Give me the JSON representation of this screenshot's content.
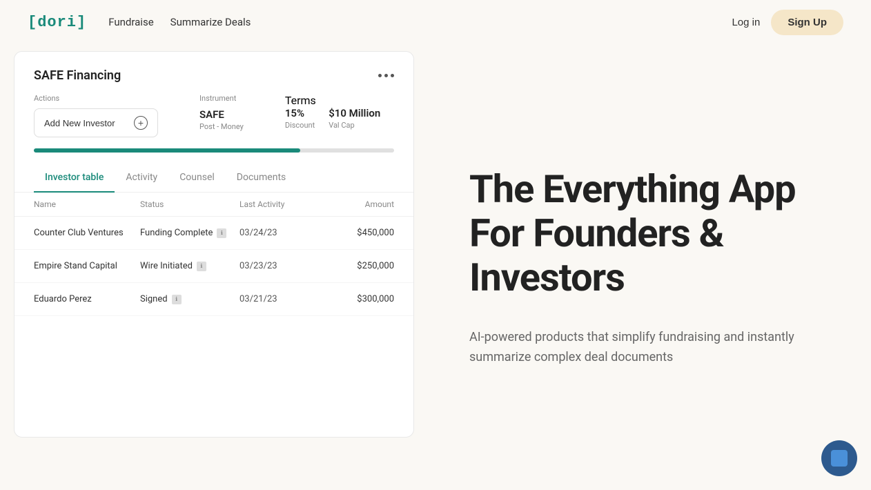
{
  "header": {
    "logo": "[dori]",
    "nav": {
      "fundraise": "Fundraise",
      "summarize_deals": "Summarize Deals"
    },
    "login_label": "Log in",
    "signup_label": "Sign Up"
  },
  "panel": {
    "title": "SAFE Financing",
    "actions_label": "Actions",
    "add_investor_label": "Add New Investor",
    "instrument_label": "Instrument",
    "instrument_value": "SAFE",
    "instrument_sub": "Post - Money",
    "terms_label": "Terms",
    "discount_value": "15%",
    "discount_sub": "Discount",
    "valcap_value": "$10 Million",
    "valcap_sub": "Val Cap",
    "progress_percent": 74,
    "tabs": [
      {
        "id": "investor-table",
        "label": "Investor table",
        "active": true
      },
      {
        "id": "activity",
        "label": "Activity",
        "active": false
      },
      {
        "id": "counsel",
        "label": "Counsel",
        "active": false
      },
      {
        "id": "documents",
        "label": "Documents",
        "active": false
      }
    ],
    "table": {
      "columns": [
        "Name",
        "Status",
        "Last Activity",
        "Amount"
      ],
      "rows": [
        {
          "name": "Counter Club Ventures",
          "status": "Funding Complete",
          "activity": "03/24/23",
          "amount": "$450,000"
        },
        {
          "name": "Empire Stand Capital",
          "status": "Wire Initiated",
          "activity": "03/23/23",
          "amount": "$250,000"
        },
        {
          "name": "Eduardo Perez",
          "status": "Signed",
          "activity": "03/21/23",
          "amount": "$300,000"
        }
      ]
    }
  },
  "hero": {
    "title": "The Everything App For Founders & Investors",
    "subtitle": "AI-powered products that simplify fundraising and instantly summarize complex deal documents"
  }
}
